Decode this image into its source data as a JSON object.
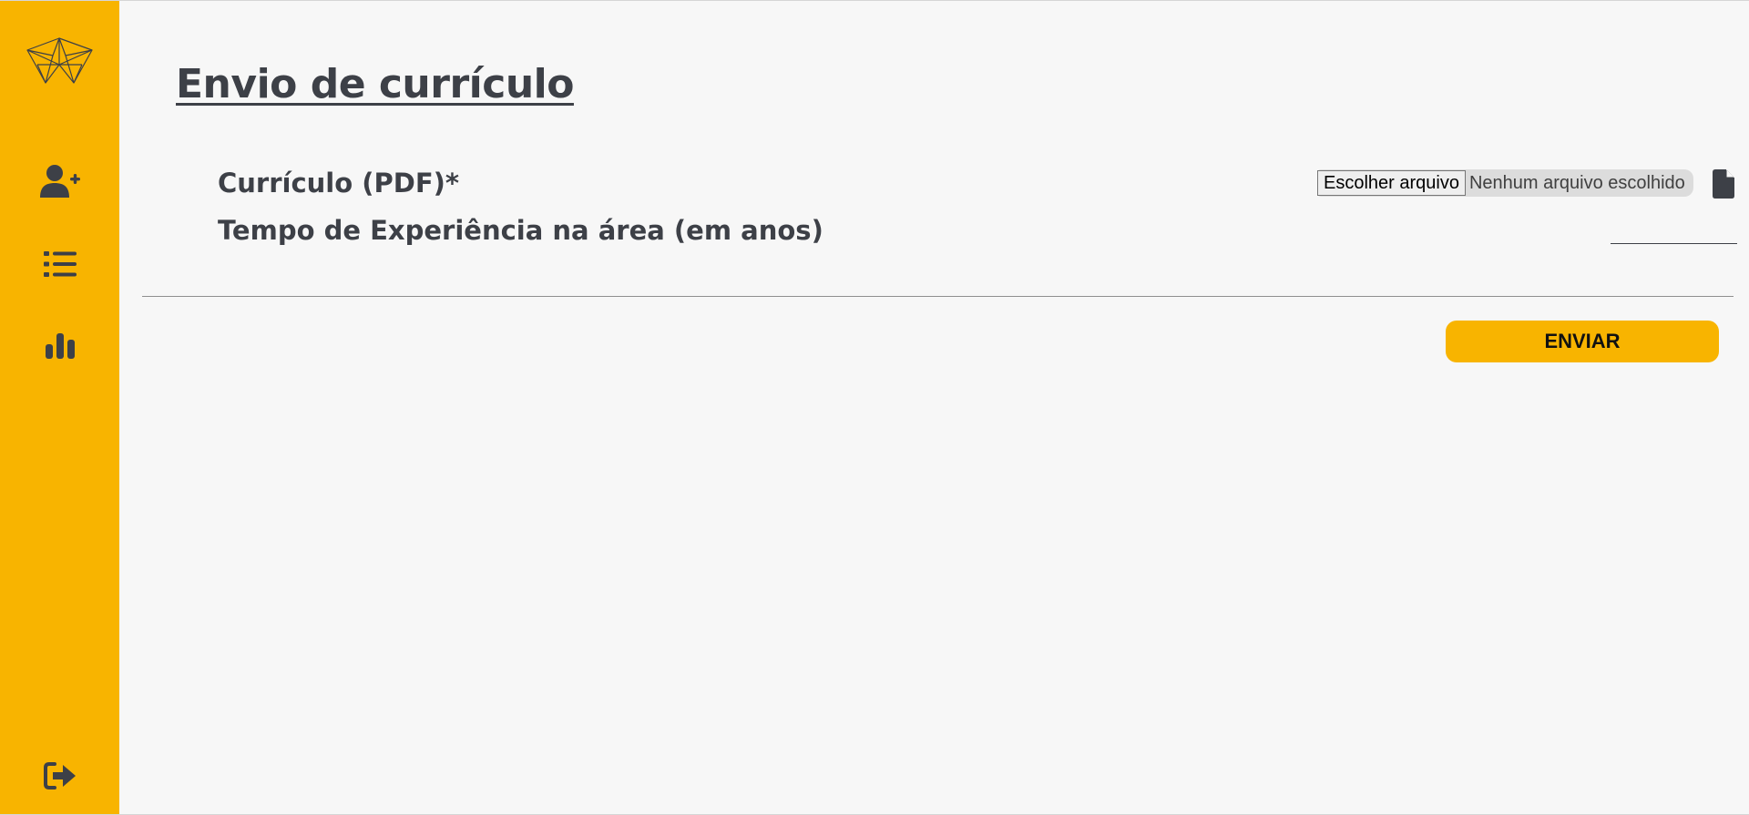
{
  "theme": {
    "accent": "#f8b400",
    "text": "#3d4047",
    "background": "#f7f7f7"
  },
  "sidebar": {
    "logo": "origami-crane-logo",
    "items": [
      {
        "icon": "user-plus-icon"
      },
      {
        "icon": "list-icon"
      },
      {
        "icon": "bar-chart-icon"
      }
    ],
    "logout": {
      "icon": "sign-out-icon"
    }
  },
  "page": {
    "title": "Envio de currículo"
  },
  "form": {
    "resume": {
      "label": "Currículo (PDF)*",
      "button_label": "Escolher arquivo",
      "status": "Nenhum arquivo escolhido",
      "icon": "file-icon"
    },
    "experience": {
      "label": "Tempo de Experiência na área (em anos)",
      "value": ""
    },
    "submit_label": "ENVIAR"
  }
}
